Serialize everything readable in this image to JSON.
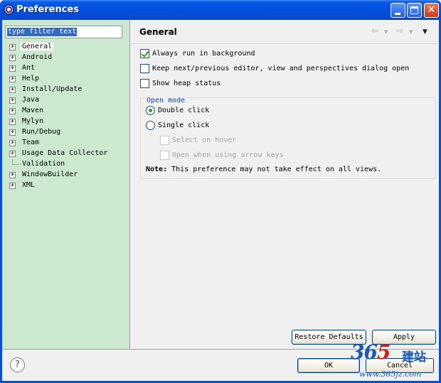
{
  "window": {
    "title": "Preferences"
  },
  "filter": {
    "text": "type filter text"
  },
  "tree": [
    {
      "label": "General",
      "expander": "+",
      "selected": true
    },
    {
      "label": "Android",
      "expander": "+"
    },
    {
      "label": "Ant",
      "expander": "+"
    },
    {
      "label": "Help",
      "expander": "+"
    },
    {
      "label": "Install/Update",
      "expander": "+"
    },
    {
      "label": "Java",
      "expander": "+"
    },
    {
      "label": "Maven",
      "expander": "+"
    },
    {
      "label": "Mylyn",
      "expander": "+"
    },
    {
      "label": "Run/Debug",
      "expander": "+"
    },
    {
      "label": "Team",
      "expander": "+"
    },
    {
      "label": "Usage Data Collector",
      "expander": "+"
    },
    {
      "label": "Validation",
      "expander": ""
    },
    {
      "label": "WindowBuilder",
      "expander": "+"
    },
    {
      "label": "XML",
      "expander": "+"
    }
  ],
  "page": {
    "title": "General",
    "options": {
      "always_run_background": {
        "label": "Always run in background",
        "checked": true
      },
      "keep_next_previous": {
        "label": "Keep next/previous editor, view and perspectives dialog open",
        "checked": false
      },
      "show_heap_status": {
        "label": "Show heap status",
        "checked": false
      }
    },
    "open_mode": {
      "title": "Open mode",
      "double_click": "Double click",
      "single_click": "Single click",
      "select_on_hover": "Select on hover",
      "open_arrow_keys": "Open when using arrow keys",
      "selected": "double_click"
    },
    "note": {
      "prefix": "Note:",
      "text": " This preference may not take effect on all views."
    }
  },
  "buttons": {
    "restore_defaults": "Restore Defaults",
    "apply": "Apply",
    "ok": "OK",
    "cancel": "Cancel"
  },
  "watermark": {
    "number_a": "36",
    "number_b": "5",
    "chinese": "建站",
    "url": "www.365jz.com"
  },
  "colors": {
    "title_bar": "#0250de",
    "tree_bg": "#cce8cf",
    "check_green": "#21a121",
    "group_title": "#0046d5"
  }
}
